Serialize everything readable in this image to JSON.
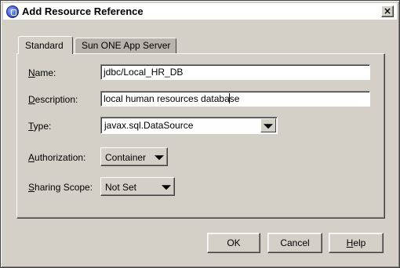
{
  "window": {
    "title": "Add Resource Reference",
    "close_glyph": "×",
    "icon": "app-globe-icon"
  },
  "tabs": [
    {
      "label": "Standard",
      "selected": true
    },
    {
      "label": "Sun ONE App Server",
      "selected": false
    }
  ],
  "form": {
    "name": {
      "label_mnemonic": "N",
      "label_rest": "ame:",
      "value": "jdbc/Local_HR_DB"
    },
    "description": {
      "label_mnemonic": "D",
      "label_rest": "escription:",
      "value_before_caret": "local human resources databa",
      "value_after_caret": "se"
    },
    "type": {
      "label_mnemonic": "T",
      "label_rest": "ype:",
      "value": "javax.sql.DataSource"
    },
    "authorization": {
      "label_mnemonic": "A",
      "label_rest": "uthorization:",
      "value": "Container"
    },
    "sharing_scope": {
      "label_mnemonic": "S",
      "label_rest": "haring Scope:",
      "value": "Not Set"
    }
  },
  "buttons": {
    "ok": "OK",
    "cancel": "Cancel",
    "help_mnemonic": "H",
    "help_rest": "elp"
  },
  "colors": {
    "dialog_bg": "#d4d0c8",
    "field_bg": "#ffffff"
  }
}
